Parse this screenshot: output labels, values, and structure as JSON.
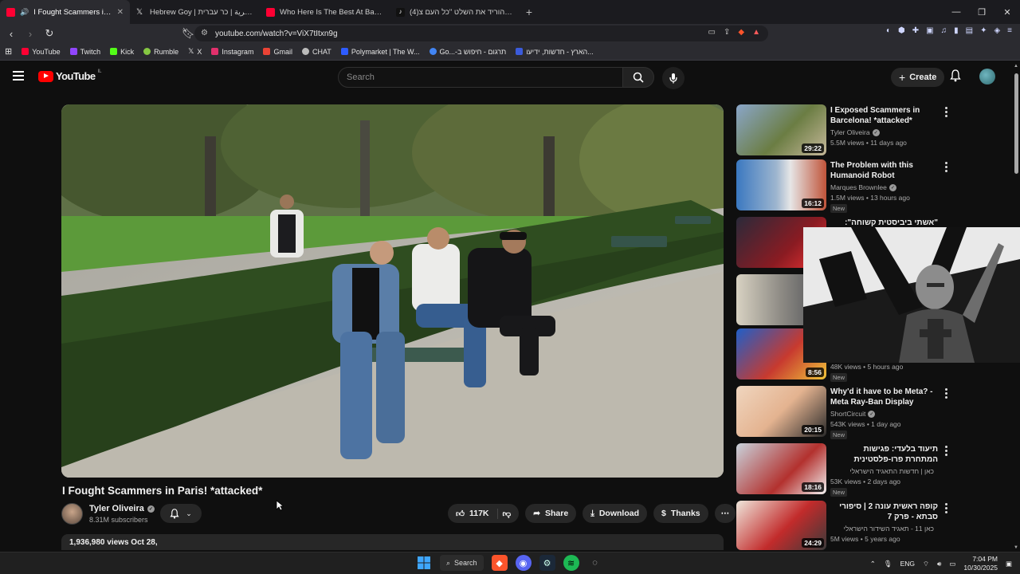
{
  "browser": {
    "tabs": [
      {
        "title": "I Fought Scammers in Paris! *",
        "favicon_color": "#ff0033",
        "active": true,
        "audio": true
      },
      {
        "title": "Hebrew Goy | عوني العبرية | כר עברית",
        "favicon": "x-icon"
      },
      {
        "title": "Who Here Is The Best At Basketball?",
        "favicon_color": "#ff0033"
      },
      {
        "title": "(4)חרדים הוריד את השלט \"כל העם צ",
        "favicon": "tiktok-icon"
      }
    ],
    "new_tab": "+",
    "url": "youtube.com/watch?v=ViX7tItxn9g",
    "bookmarks": [
      {
        "label": "YouTube",
        "color": "#ff0033"
      },
      {
        "label": "Twitch",
        "color": "#9146ff"
      },
      {
        "label": "Kick",
        "color": "#53fc18"
      },
      {
        "label": "Rumble",
        "color": "#85c742"
      },
      {
        "label": "X",
        "color": "#dddddd"
      },
      {
        "label": "Instagram",
        "color": "#e1306c"
      },
      {
        "label": "Gmail",
        "color": "#ea4335"
      },
      {
        "label": "CHAT",
        "color": "#bbbbbb"
      },
      {
        "label": "Polymarket | The W...",
        "color": "#2e5cff"
      },
      {
        "label": "Go...-תרגום - חיפוש ב",
        "color": "#4285f4"
      },
      {
        "label": "הארץ - חדשות, ידיעו...",
        "color": "#3b5bdb"
      }
    ]
  },
  "yt": {
    "logo": "YouTube",
    "country": "IL",
    "search_placeholder": "Search",
    "create_label": "Create",
    "video": {
      "title": "I Fought Scammers in Paris! *attacked*",
      "channel": "Tyler Oliveira",
      "subscribers": "8.31M subscribers",
      "likes": "117K",
      "share": "Share",
      "download": "Download",
      "thanks": "Thanks",
      "views_date": "1,936,980 views  Oct 28,"
    },
    "recommendations": [
      {
        "title": "I Exposed Scammers in Barcelona! *attacked*",
        "channel": "Tyler Oliveira",
        "verified": true,
        "meta": "5.5M views • 11 days ago",
        "duration": "29:22",
        "new": false
      },
      {
        "title": "The Problem with this Humanoid Robot",
        "channel": "Marques Brownlee",
        "verified": true,
        "meta": "1.5M views • 13 hours ago",
        "duration": "16:12",
        "new": true
      },
      {
        "title": "\"אשתי ביביסטית קשוחה\": מאיר עבר,",
        "channel": "",
        "meta": "",
        "duration": "",
        "rtl": true
      },
      {
        "title": "",
        "channel": "",
        "meta": "",
        "duration": ""
      },
      {
        "title": "",
        "channel": "",
        "meta": "48K views • 5 hours ago",
        "duration": "8:56",
        "new": true
      },
      {
        "title": "Why'd it have to be Meta? - Meta Ray-Ban Display",
        "channel": "ShortCircuit",
        "verified": true,
        "meta": "543K views • 1 day ago",
        "duration": "20:15",
        "new": true
      },
      {
        "title": "תיעוד בלעדי: פגישות המתחרת פרו-פלסטינית באוניברסיטה היוקרה...",
        "channel": "כאן | חדשות התאגיד הישראלי",
        "meta": "53K views • 2 days ago",
        "duration": "18:16",
        "new": true,
        "rtl": true
      },
      {
        "title": "קופה ראשית עונה 2 | סיפורי סבתא - פרק 7",
        "channel": "כאן 11 - תאגיד השידור הישראלי",
        "meta": "5M views • 5 years ago",
        "duration": "24:29",
        "rtl": true
      }
    ]
  },
  "taskbar": {
    "search": "Search",
    "lang": "ENG",
    "time": "7:04 PM",
    "date": "10/30/2025"
  }
}
